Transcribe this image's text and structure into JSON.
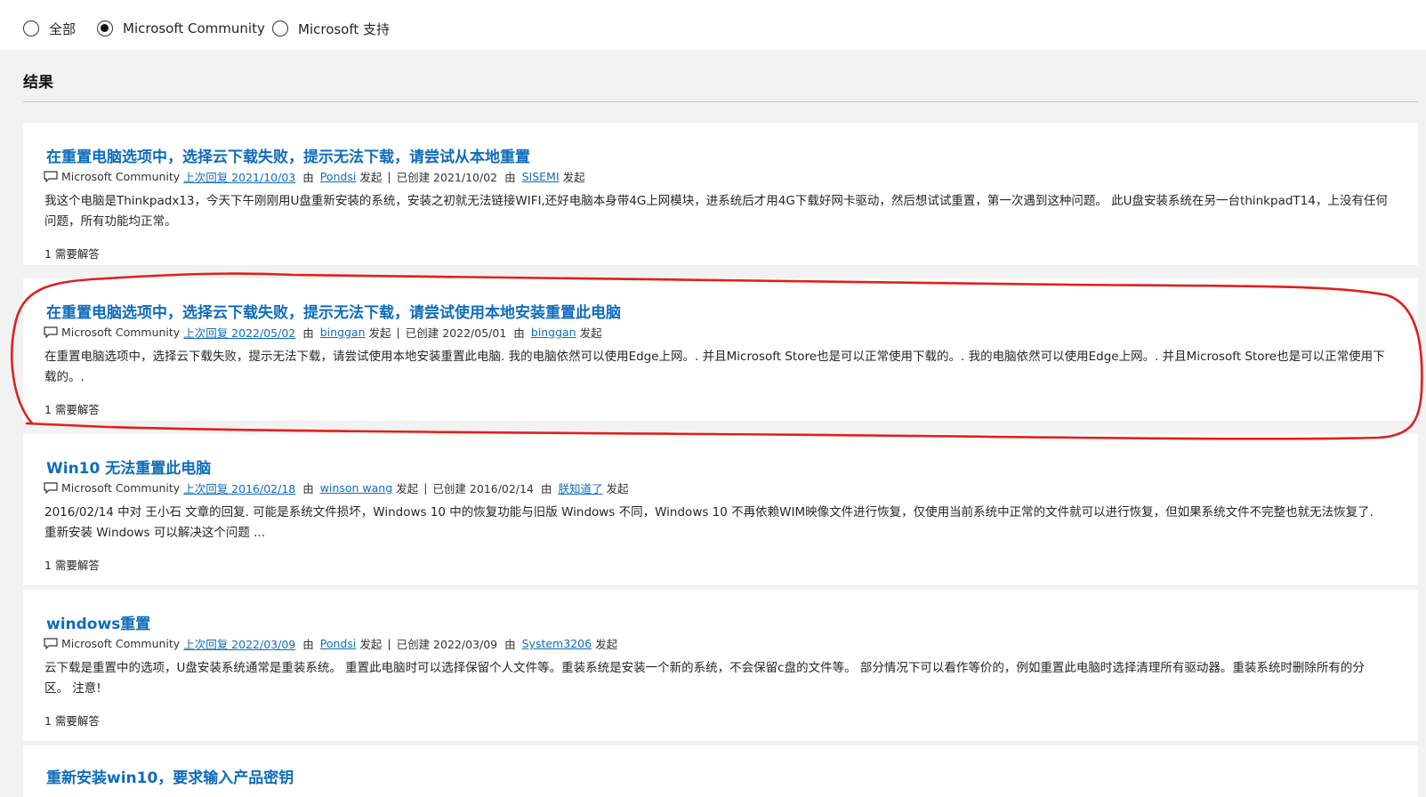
{
  "filters": {
    "options": [
      {
        "label": "全部",
        "checked": false
      },
      {
        "label": "Microsoft Community",
        "checked": true
      },
      {
        "label": "Microsoft 支持",
        "checked": false
      }
    ]
  },
  "results": {
    "heading": "结果",
    "items": [
      {
        "title": "在重置电脑选项中，选择云下载失败，提示无法下载，请尝试从本地重置",
        "forum": "Microsoft Community",
        "last_reply": "上次回复 2021/10/03",
        "by_label": "由",
        "last_reply_user": "Pondsi",
        "started_label": "发起",
        "created": "已创建 2021/10/02",
        "creator": "SISEMI",
        "snippet": "我这个电脑是Thinkpadx13，今天下午刚刚用U盘重新安装的系统，安装之初就无法链接WIFI,还好电脑本身带4G上网模块，进系统后才用4G下载好网卡驱动，然后想试试重置，第一次遇到这种问题。 此U盘安装系统在另一台thinkpadT14，上没有任何问题，所有功能均正常。",
        "answers": "1 需要解答"
      },
      {
        "title": "在重置电脑选项中，选择云下载失败，提示无法下载，请尝试使用本地安装重置此电脑",
        "forum": "Microsoft Community",
        "last_reply": "上次回复 2022/05/02",
        "by_label": "由",
        "last_reply_user": "binggan",
        "started_label": "发起",
        "created": "已创建 2022/05/01",
        "creator": "binggan",
        "snippet": "在重置电脑选项中，选择云下载失败，提示无法下载，请尝试使用本地安装重置此电脑. 我的电脑依然可以使用Edge上网。. 并且Microsoft Store也是可以正常使用下载的。. 我的电脑依然可以使用Edge上网。. 并且Microsoft Store也是可以正常使用下载的。.",
        "answers": "1 需要解答"
      },
      {
        "title": "Win10 无法重置此电脑",
        "forum": "Microsoft Community",
        "last_reply": "上次回复 2016/02/18",
        "by_label": "由",
        "last_reply_user": "winson wang",
        "started_label": "发起",
        "created": "已创建 2016/02/14",
        "creator": "朕知道了",
        "snippet": "2016/02/14 中对 王小石 文章的回复. 可能是系统文件损坏，Windows 10 中的恢复功能与旧版 Windows 不同，Windows 10 不再依赖WIM映像文件进行恢复，仅使用当前系统中正常的文件就可以进行恢复，但如果系统文件不完整也就无法恢复了. 重新安装 Windows 可以解决这个问题 ...",
        "answers": "1 需要解答"
      },
      {
        "title": "windows重置",
        "forum": "Microsoft Community",
        "last_reply": "上次回复 2022/03/09",
        "by_label": "由",
        "last_reply_user": "Pondsi",
        "started_label": "发起",
        "created": "已创建 2022/03/09",
        "creator": "System3206",
        "snippet": "云下载是重置中的选项，U盘安装系统通常是重装系统。 重置此电脑时可以选择保留个人文件等。重装系统是安装一个新的系统，不会保留c盘的文件等。 部分情况下可以看作等价的，例如重置此电脑时选择清理所有驱动器。重装系统时删除所有的分区。 注意!",
        "answers": "1 需要解答"
      },
      {
        "title": "重新安装win10，要求输入产品密钥"
      }
    ]
  },
  "colors": {
    "link": "#0f6cbd",
    "annotation": "#e0201c",
    "background": "#f2f2f2",
    "card": "#ffffff"
  },
  "icons": {
    "forum": "forum-icon",
    "author": "author-icon"
  }
}
